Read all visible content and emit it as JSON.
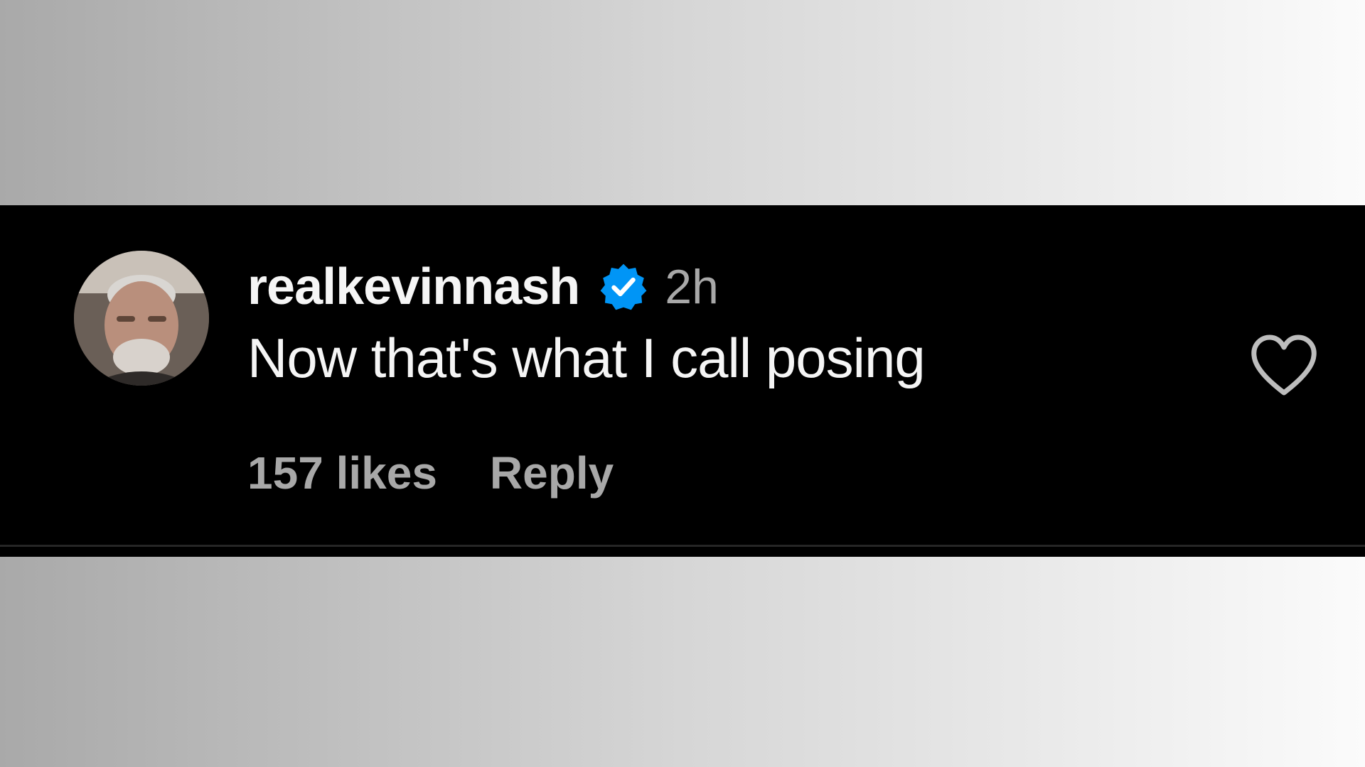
{
  "comment": {
    "username": "realkevinnash",
    "verified_icon": "verified-badge-icon",
    "timestamp": "2h",
    "text": "Now that's what I call posing",
    "likes": "157 likes",
    "reply_label": "Reply",
    "like_icon": "heart-outline-icon"
  },
  "colors": {
    "card_background": "#000000",
    "primary_text": "#f5f5f5",
    "secondary_text": "#a8a8a8",
    "verified_blue": "#0095f6"
  }
}
